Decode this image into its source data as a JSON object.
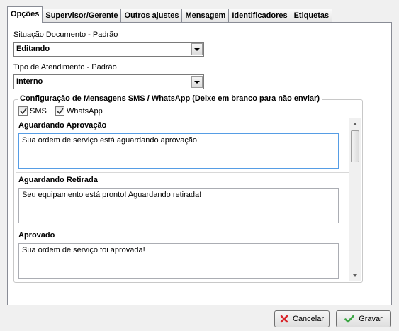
{
  "tabs": [
    {
      "label": "Opções",
      "active": true
    },
    {
      "label": "Supervisor/Gerente",
      "active": false
    },
    {
      "label": "Outros ajustes",
      "active": false
    },
    {
      "label": "Mensagem",
      "active": false
    },
    {
      "label": "Identificadores",
      "active": false
    },
    {
      "label": "Etiquetas",
      "active": false
    }
  ],
  "situacao": {
    "label": "Situação Documento - Padrão",
    "value": "Editando"
  },
  "atendimento": {
    "label": "Tipo de Atendimento - Padrão",
    "value": "Interno"
  },
  "sms_config": {
    "title": "Configuração de Mensagens SMS / WhatsApp (Deixe em branco para não enviar)",
    "sms": {
      "label": "SMS",
      "checked": true
    },
    "whatsapp": {
      "label": "WhatsApp",
      "checked": true
    },
    "messages": [
      {
        "title": "Aguardando Aprovação",
        "text": "Sua ordem de serviço está aguardando aprovação!"
      },
      {
        "title": "Aguardando Retirada",
        "text": "Seu equipamento está pronto! Aguardando retirada!"
      },
      {
        "title": "Aprovado",
        "text": "Sua ordem de serviço foi aprovada!"
      }
    ]
  },
  "buttons": {
    "cancel": {
      "label": "Cancelar",
      "accel": "C",
      "rest": "ancelar"
    },
    "save": {
      "label": "Gravar",
      "accel": "G",
      "rest": "ravar"
    }
  },
  "colors": {
    "cancel_icon": "#d9262b",
    "save_icon": "#3aa542"
  }
}
